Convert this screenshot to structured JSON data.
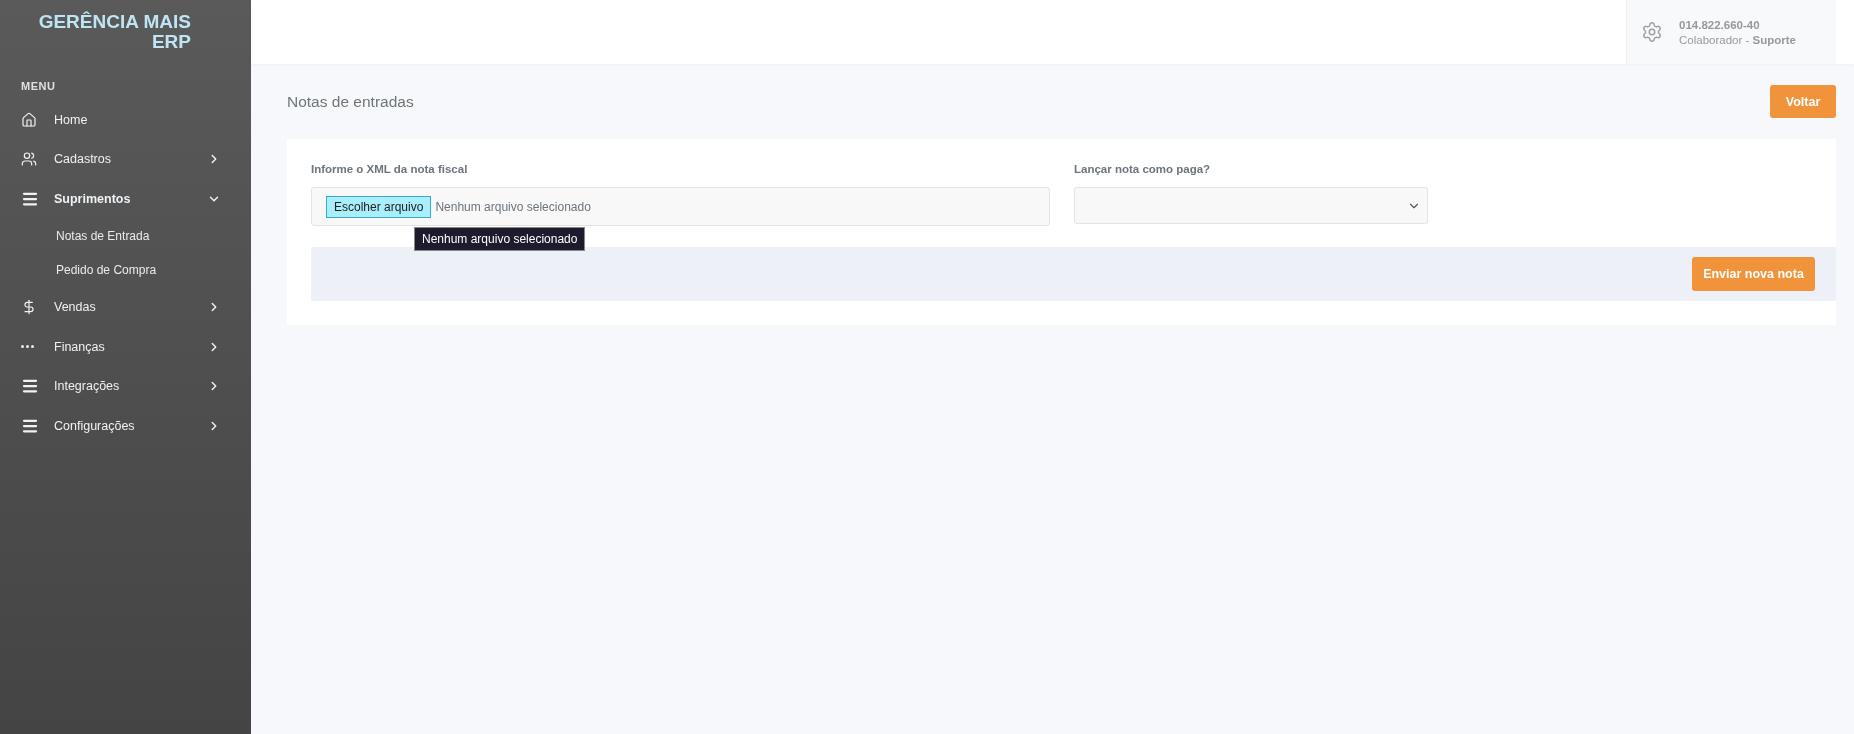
{
  "brand": {
    "line1": "GERÊNCIA MAIS",
    "line2": "ERP"
  },
  "menu": {
    "heading": "MENU",
    "items": [
      {
        "label": "Home",
        "kind": "link"
      },
      {
        "label": "Cadastros",
        "kind": "group",
        "expanded": false
      },
      {
        "label": "Suprimentos",
        "kind": "group",
        "expanded": true,
        "children": [
          {
            "label": "Notas de Entrada"
          },
          {
            "label": "Pedido de Compra"
          }
        ]
      },
      {
        "label": "Vendas",
        "kind": "group",
        "expanded": false
      },
      {
        "label": "Finanças",
        "kind": "group",
        "expanded": false
      },
      {
        "label": "Integrações",
        "kind": "group",
        "expanded": false
      },
      {
        "label": "Configurações",
        "kind": "group",
        "expanded": false
      }
    ]
  },
  "user": {
    "id": "014.822.660-40",
    "role": "Colaborador - **Suporte**"
  },
  "page": {
    "title": "Notas de entradas",
    "back_button": "Voltar"
  },
  "form": {
    "xml_label": "Informe o XML da nota fiscal",
    "file_button": "Escolher arquivo",
    "file_status": "Nenhum arquivo selecionado",
    "tooltip": "Nenhum arquivo selecionado",
    "paid_label": "Lançar nota como paga?",
    "submit_button": "Enviar nova nota"
  }
}
